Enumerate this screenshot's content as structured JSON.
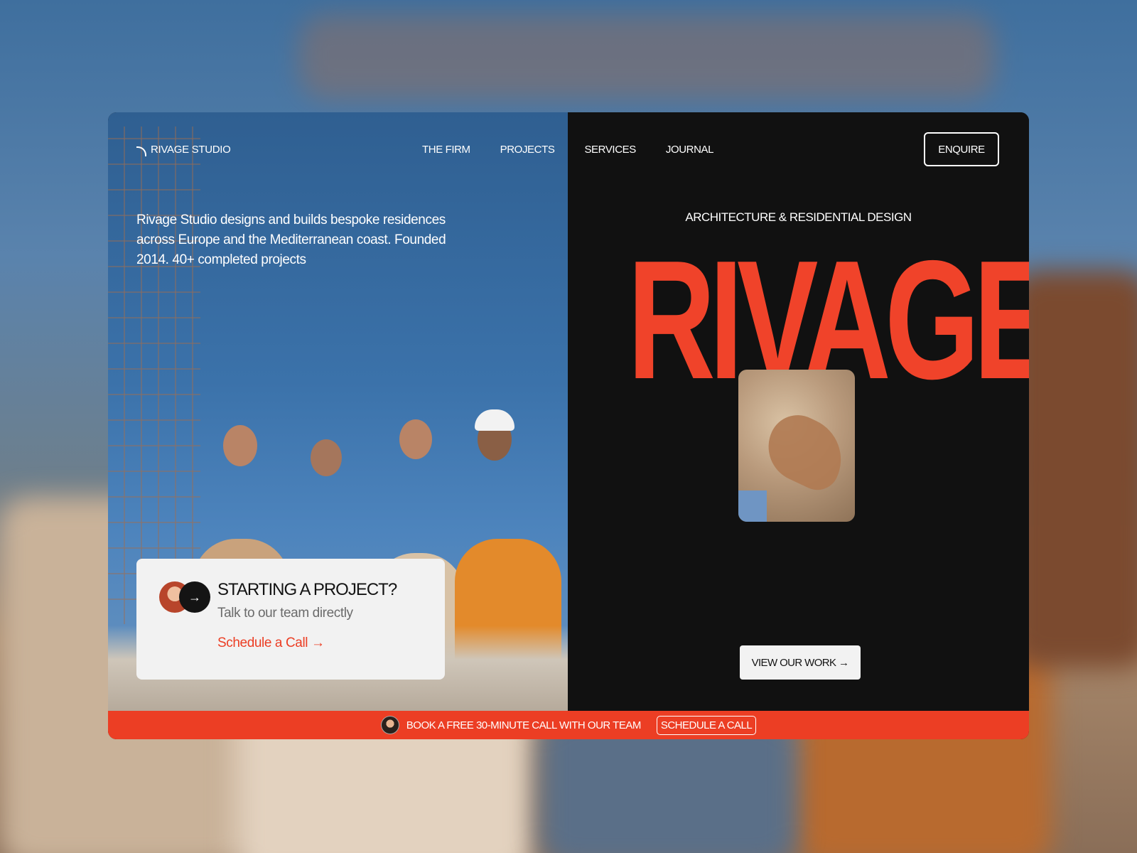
{
  "brand": {
    "name": "RIVAGE STUDIO",
    "logo_icon": "arc-logo-icon",
    "accent_color": "#ec3e24",
    "dark_color": "#111111"
  },
  "nav": {
    "links": [
      "THE FIRM",
      "PROJECTS",
      "SERVICES",
      "JOURNAL"
    ],
    "enquire_label": "ENQUIRE"
  },
  "intro": {
    "text": "Rivage Studio designs and builds bespoke residences across Europe and the Mediterranean coast. Founded 2014. 40+ completed projects"
  },
  "contact_card": {
    "title": "STARTING A PROJECT?",
    "subtitle": "Talk to our team directly",
    "link_label": "Schedule a Call →",
    "arrow_icon": "arrow-right-icon"
  },
  "hero": {
    "tagline": "ARCHITECTURE & RESIDENTIAL DESIGN",
    "title": "RIVAGE",
    "cta_label": "VIEW OUR WORK →"
  },
  "banner": {
    "text": "BOOK A FREE 30-MINUTE CALL WITH OUR TEAM",
    "button_label": "SCHEDULE A CALL"
  }
}
